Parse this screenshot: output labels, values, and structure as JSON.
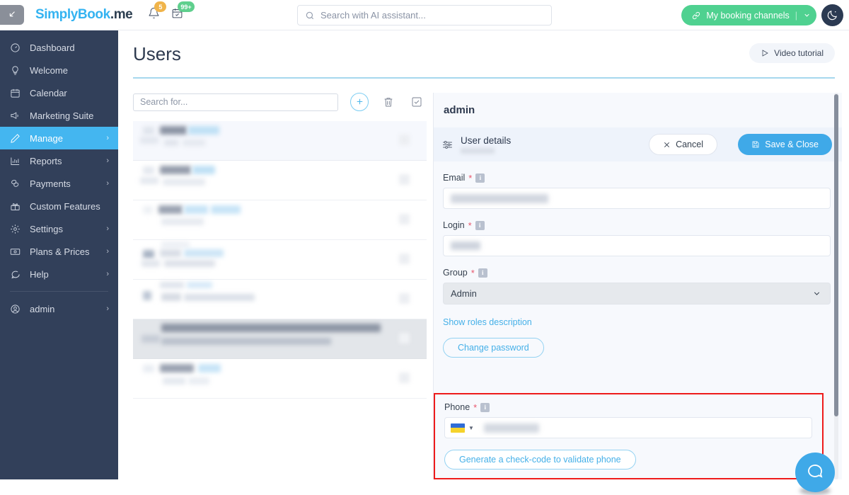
{
  "topbar": {
    "collapse_icon": "collapse-arrow-icon",
    "brand_part1": "SimplyBook",
    "brand_part2": ".me",
    "bell_icon": "bell-icon",
    "bell_badge": "5",
    "calendar_icon": "calendar-check-icon",
    "calendar_badge": "99+",
    "search_placeholder": "Search with AI assistant...",
    "search_value": "",
    "search_icon": "search-icon",
    "booking_label": "My booking channels",
    "booking_icon": "link-icon",
    "booking_caret": "chevron-down-icon",
    "theme_icon": "moon-icon",
    "accent_green": "#4fd190",
    "accent_blue": "#44b6f0"
  },
  "sidebar": {
    "items": [
      {
        "label": "Dashboard",
        "icon": "dashboard-icon",
        "chevron": false,
        "active": false
      },
      {
        "label": "Welcome",
        "icon": "lightbulb-icon",
        "chevron": false,
        "active": false
      },
      {
        "label": "Calendar",
        "icon": "calendar-icon",
        "chevron": false,
        "active": false
      },
      {
        "label": "Marketing Suite",
        "icon": "megaphone-icon",
        "chevron": false,
        "active": false
      },
      {
        "label": "Manage",
        "icon": "pencil-icon",
        "chevron": true,
        "active": true
      },
      {
        "label": "Reports",
        "icon": "bar-chart-icon",
        "chevron": true,
        "active": false
      },
      {
        "label": "Payments",
        "icon": "coins-icon",
        "chevron": true,
        "active": false
      },
      {
        "label": "Custom Features",
        "icon": "gift-icon",
        "chevron": false,
        "active": false
      },
      {
        "label": "Settings",
        "icon": "gear-icon",
        "chevron": true,
        "active": false
      },
      {
        "label": "Plans & Prices",
        "icon": "banknote-icon",
        "chevron": true,
        "active": false
      },
      {
        "label": "Help",
        "icon": "chat-icon",
        "chevron": true,
        "active": false
      }
    ],
    "account": {
      "label": "admin",
      "icon": "user-circle-icon",
      "chevron": true
    }
  },
  "page": {
    "title": "Users",
    "video_tutorial": "Video tutorial",
    "play_icon": "play-icon"
  },
  "list": {
    "search_placeholder": "Search for...",
    "search_value": "",
    "add_icon": "plus-circle-icon",
    "delete_icon": "trash-icon",
    "select_all_icon": "checkbox-checked-icon",
    "rows": [
      {
        "state": "selected-light",
        "redacted": true
      },
      {
        "state": "normal",
        "redacted": true
      },
      {
        "state": "normal",
        "redacted": true
      },
      {
        "state": "normal",
        "redacted": true
      },
      {
        "state": "normal",
        "redacted": true
      },
      {
        "state": "highlighted",
        "redacted": true
      },
      {
        "state": "normal",
        "redacted": true
      }
    ]
  },
  "detail": {
    "title": "admin",
    "section_icon": "sliders-icon",
    "section_title": "User details",
    "section_subtitle_redacted": true,
    "cancel_label": "Cancel",
    "cancel_icon": "close-icon",
    "save_label": "Save & Close",
    "save_icon": "floppy-disk-icon",
    "info_icon": "info-icon",
    "required_mark": "*",
    "fields": {
      "email": {
        "label": "Email",
        "value_redacted": true
      },
      "login": {
        "label": "Login",
        "value_redacted": true
      },
      "group": {
        "label": "Group",
        "value": "Admin",
        "caret": "chevron-down-icon"
      },
      "phone": {
        "label": "Phone",
        "value_redacted": true,
        "country_flag": "ukraine-flag-icon"
      }
    },
    "roles_link": "Show roles description",
    "change_password": "Change password",
    "generate_code": "Generate a check-code to validate phone",
    "highlight_color": "#ee1b1b"
  },
  "chat": {
    "icon": "chat-bubble-icon"
  }
}
